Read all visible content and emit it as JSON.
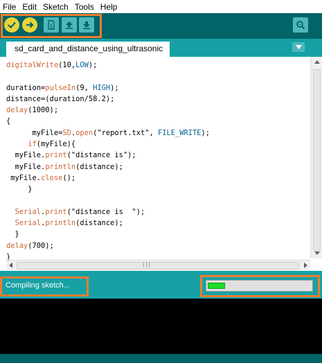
{
  "menu": {
    "items": [
      "File",
      "Edit",
      "Sketch",
      "Tools",
      "Help"
    ]
  },
  "toolbar": {
    "buttons": [
      {
        "icon": "verify-icon"
      },
      {
        "icon": "upload-icon"
      },
      {
        "icon": "new-file-icon"
      },
      {
        "icon": "open-icon"
      },
      {
        "icon": "save-icon"
      }
    ],
    "serial_monitor_icon": "serial-monitor-icon",
    "accent_color": "#f07e2d"
  },
  "tab": {
    "label": "sd_card_and_distance_using_ultrasonic"
  },
  "code": {
    "lines": [
      [
        {
          "t": "digitalWrite",
          "c": "kw-orange"
        },
        {
          "t": "(10,",
          "c": ""
        },
        {
          "t": "LOW",
          "c": "kw-const"
        },
        {
          "t": ");",
          "c": ""
        }
      ],
      [],
      [
        {
          "t": "duration=",
          "c": ""
        },
        {
          "t": "pulseIn",
          "c": "kw-orange"
        },
        {
          "t": "(9, ",
          "c": ""
        },
        {
          "t": "HIGH",
          "c": "kw-const"
        },
        {
          "t": ");",
          "c": ""
        }
      ],
      [
        {
          "t": "distance=(duration/58.2);",
          "c": ""
        }
      ],
      [
        {
          "t": "delay",
          "c": "kw-orange"
        },
        {
          "t": "(1000);",
          "c": ""
        }
      ],
      [
        {
          "t": "{",
          "c": ""
        }
      ],
      [
        {
          "t": "      myFile=",
          "c": ""
        },
        {
          "t": "SD",
          "c": "kw-orange"
        },
        {
          "t": ".",
          "c": ""
        },
        {
          "t": "open",
          "c": "kw-orange"
        },
        {
          "t": "(\"report.txt\", ",
          "c": ""
        },
        {
          "t": "FILE_WRITE",
          "c": "kw-const"
        },
        {
          "t": ");",
          "c": ""
        }
      ],
      [
        {
          "t": "     ",
          "c": ""
        },
        {
          "t": "if",
          "c": "kw-orange"
        },
        {
          "t": "(myFile){",
          "c": ""
        }
      ],
      [
        {
          "t": "  myFile.",
          "c": ""
        },
        {
          "t": "print",
          "c": "kw-orange"
        },
        {
          "t": "(\"distance is\");",
          "c": ""
        }
      ],
      [
        {
          "t": "  myFile.",
          "c": ""
        },
        {
          "t": "println",
          "c": "kw-orange"
        },
        {
          "t": "(distance);",
          "c": ""
        }
      ],
      [
        {
          "t": " myFile.",
          "c": ""
        },
        {
          "t": "close",
          "c": "kw-orange"
        },
        {
          "t": "();",
          "c": ""
        }
      ],
      [
        {
          "t": "     }",
          "c": ""
        }
      ],
      [],
      [
        {
          "t": "  ",
          "c": ""
        },
        {
          "t": "Serial",
          "c": "kw-orange"
        },
        {
          "t": ".",
          "c": ""
        },
        {
          "t": "print",
          "c": "kw-orange"
        },
        {
          "t": "(\"distance is  \");",
          "c": ""
        }
      ],
      [
        {
          "t": "  ",
          "c": ""
        },
        {
          "t": "Serial",
          "c": "kw-orange"
        },
        {
          "t": ".",
          "c": ""
        },
        {
          "t": "println",
          "c": "kw-orange"
        },
        {
          "t": "(distance);",
          "c": ""
        }
      ],
      [
        {
          "t": "  }",
          "c": ""
        }
      ],
      [
        {
          "t": "delay",
          "c": "kw-orange"
        },
        {
          "t": "(700);",
          "c": ""
        }
      ],
      [
        {
          "t": "}",
          "c": ""
        }
      ]
    ]
  },
  "status": {
    "text": "Compiling sketch...",
    "progress": 0.17
  },
  "colors": {
    "toolbar_bg": "#006468",
    "tab_bar_bg": "#17a1a5",
    "highlight": "#f07e2d",
    "progress_fill": "#1edc2a"
  }
}
